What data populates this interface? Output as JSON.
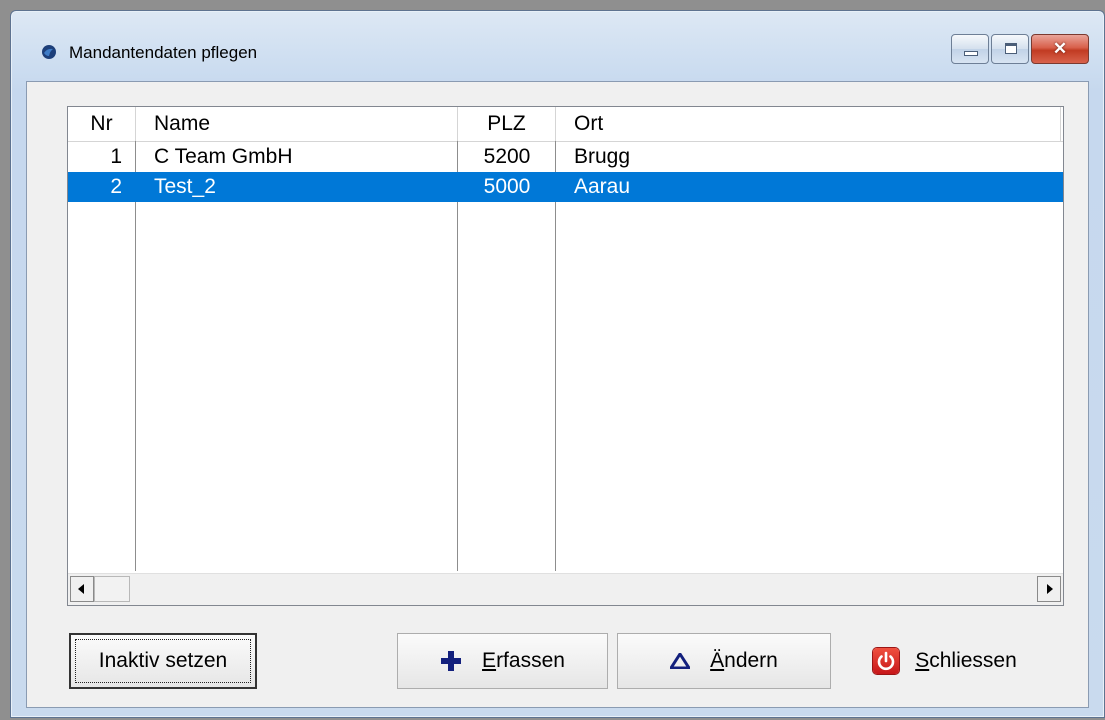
{
  "window": {
    "title": "Mandantendaten pflegen",
    "buttons": {
      "minimize": "minimize",
      "maximize": "maximize",
      "close": "close"
    }
  },
  "list": {
    "columns": [
      "Nr",
      "Name",
      "PLZ",
      "Ort"
    ],
    "rows": [
      {
        "nr": "1",
        "name": "C Team GmbH",
        "plz": "5200",
        "ort": "Brugg",
        "selected": false
      },
      {
        "nr": "2",
        "name": "Test_2",
        "plz": "5000",
        "ort": "Aarau",
        "selected": true
      }
    ]
  },
  "buttons": {
    "inaktiv": "Inaktiv setzen",
    "erfassen": {
      "accel": "E",
      "rest": "rfassen",
      "icon": "plus-icon"
    },
    "aendern": {
      "accel": "Ä",
      "rest": "ndern",
      "icon": "delta-icon"
    },
    "schliessen": {
      "accel": "S",
      "rest": "chliessen",
      "icon": "power-icon"
    }
  },
  "colors": {
    "selection": "#0078d7",
    "plus_icon": "#13207d",
    "power_icon": "#d9232a"
  }
}
